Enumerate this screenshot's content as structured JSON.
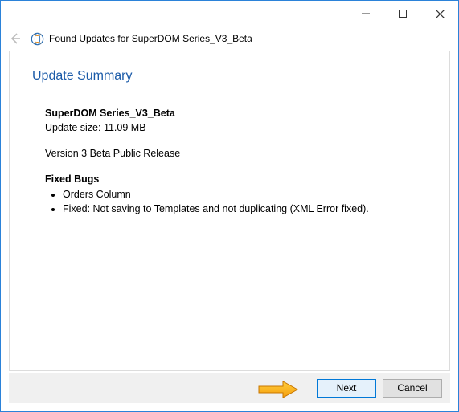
{
  "window": {
    "title": "Found Updates for SuperDOM Series_V3_Beta"
  },
  "content": {
    "heading": "Update Summary",
    "product_name": "SuperDOM Series_V3_Beta",
    "size_line": "Update size: 11.09 MB",
    "release_line": "Version 3 Beta Public Release",
    "bugs_heading": "Fixed Bugs",
    "bugs": [
      "Orders Column",
      "Fixed: Not saving to Templates and not duplicating (XML Error fixed)."
    ]
  },
  "footer": {
    "next_label": "Next",
    "cancel_label": "Cancel"
  }
}
